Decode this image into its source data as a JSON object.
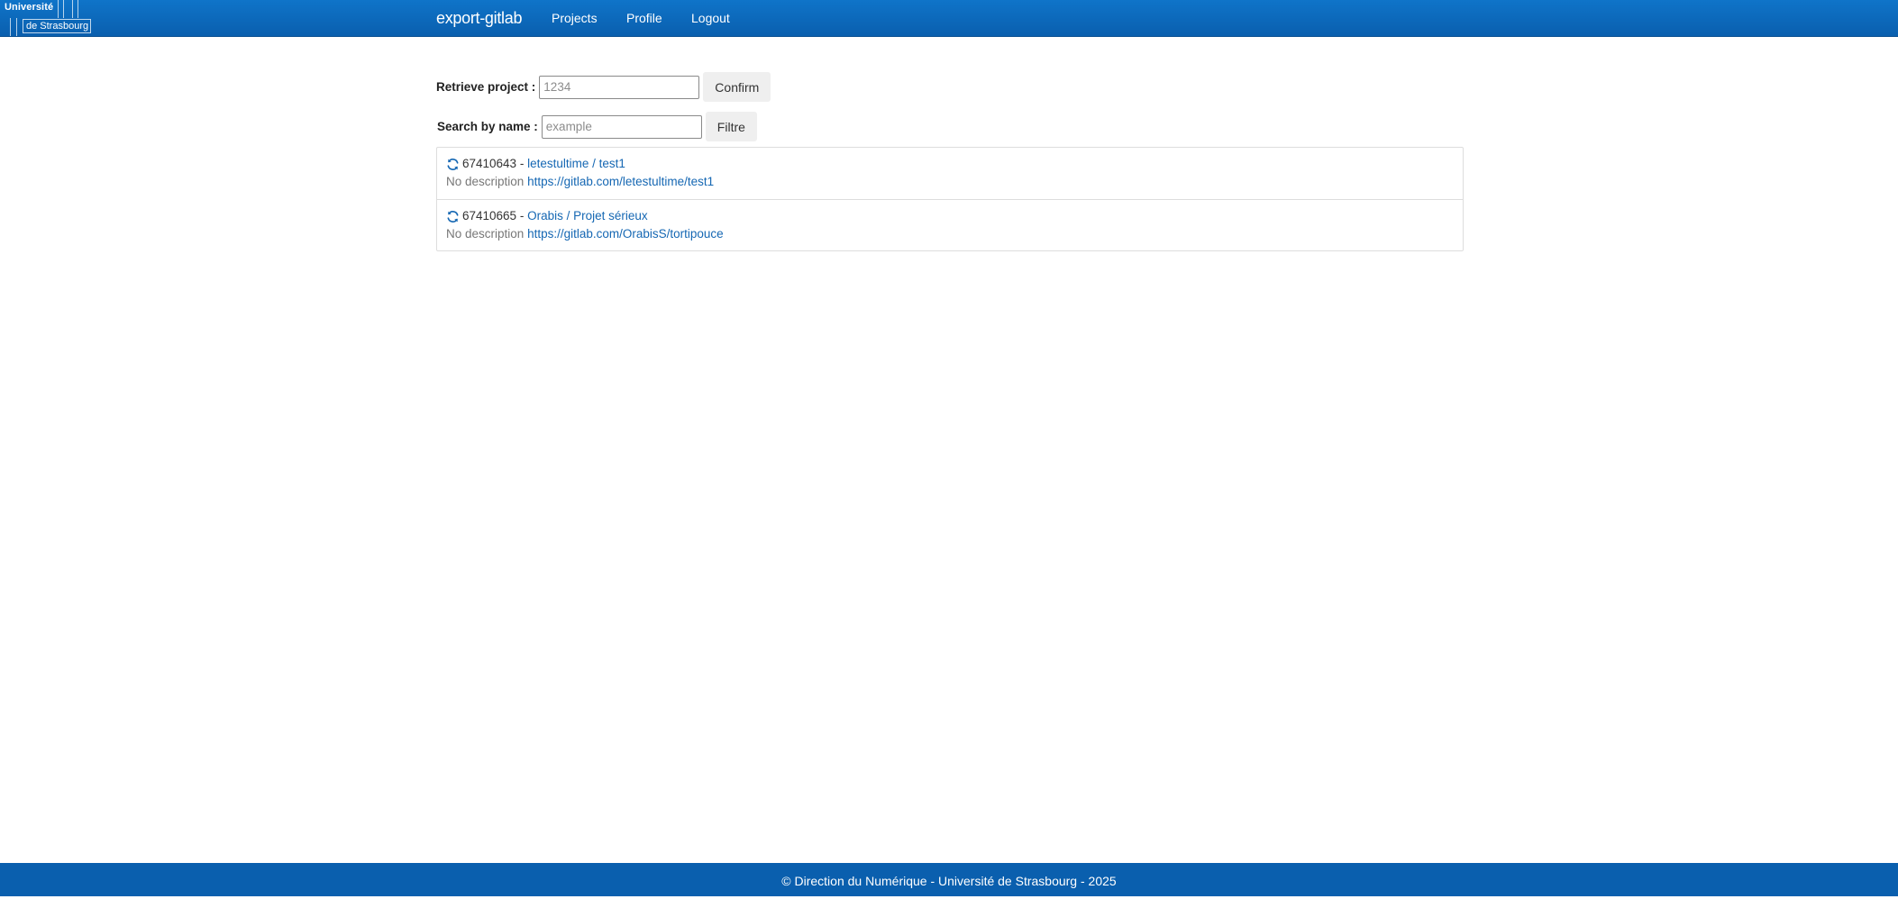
{
  "logo": {
    "line1": "Université",
    "line2": "de Strasbourg"
  },
  "navbar": {
    "brand": "export-gitlab",
    "links": [
      {
        "label": "Projects"
      },
      {
        "label": "Profile"
      },
      {
        "label": "Logout"
      }
    ]
  },
  "retrieve": {
    "label": "Retrieve project :",
    "value": "",
    "placeholder": "1234",
    "button_label": "Confirm"
  },
  "search": {
    "label": "Search by name :",
    "value": "",
    "placeholder": "example",
    "button_label": "Filtre"
  },
  "projects": [
    {
      "icon": "refresh-icon",
      "id": "67410643",
      "separator": "-",
      "name": "letestultime / test1",
      "description": "No description",
      "url": "https://gitlab.com/letestultime/test1"
    },
    {
      "icon": "refresh-icon",
      "id": "67410665",
      "separator": "-",
      "name": "Orabis / Projet sérieux",
      "description": "No description",
      "url": "https://gitlab.com/OrabisS/tortipouce"
    }
  ],
  "footer": {
    "text": "© Direction du Numérique - Université de Strasbourg - 2025"
  },
  "colors": {
    "navbar": "#0a5fae",
    "link": "#1567b3",
    "footer": "#0a5fae"
  }
}
